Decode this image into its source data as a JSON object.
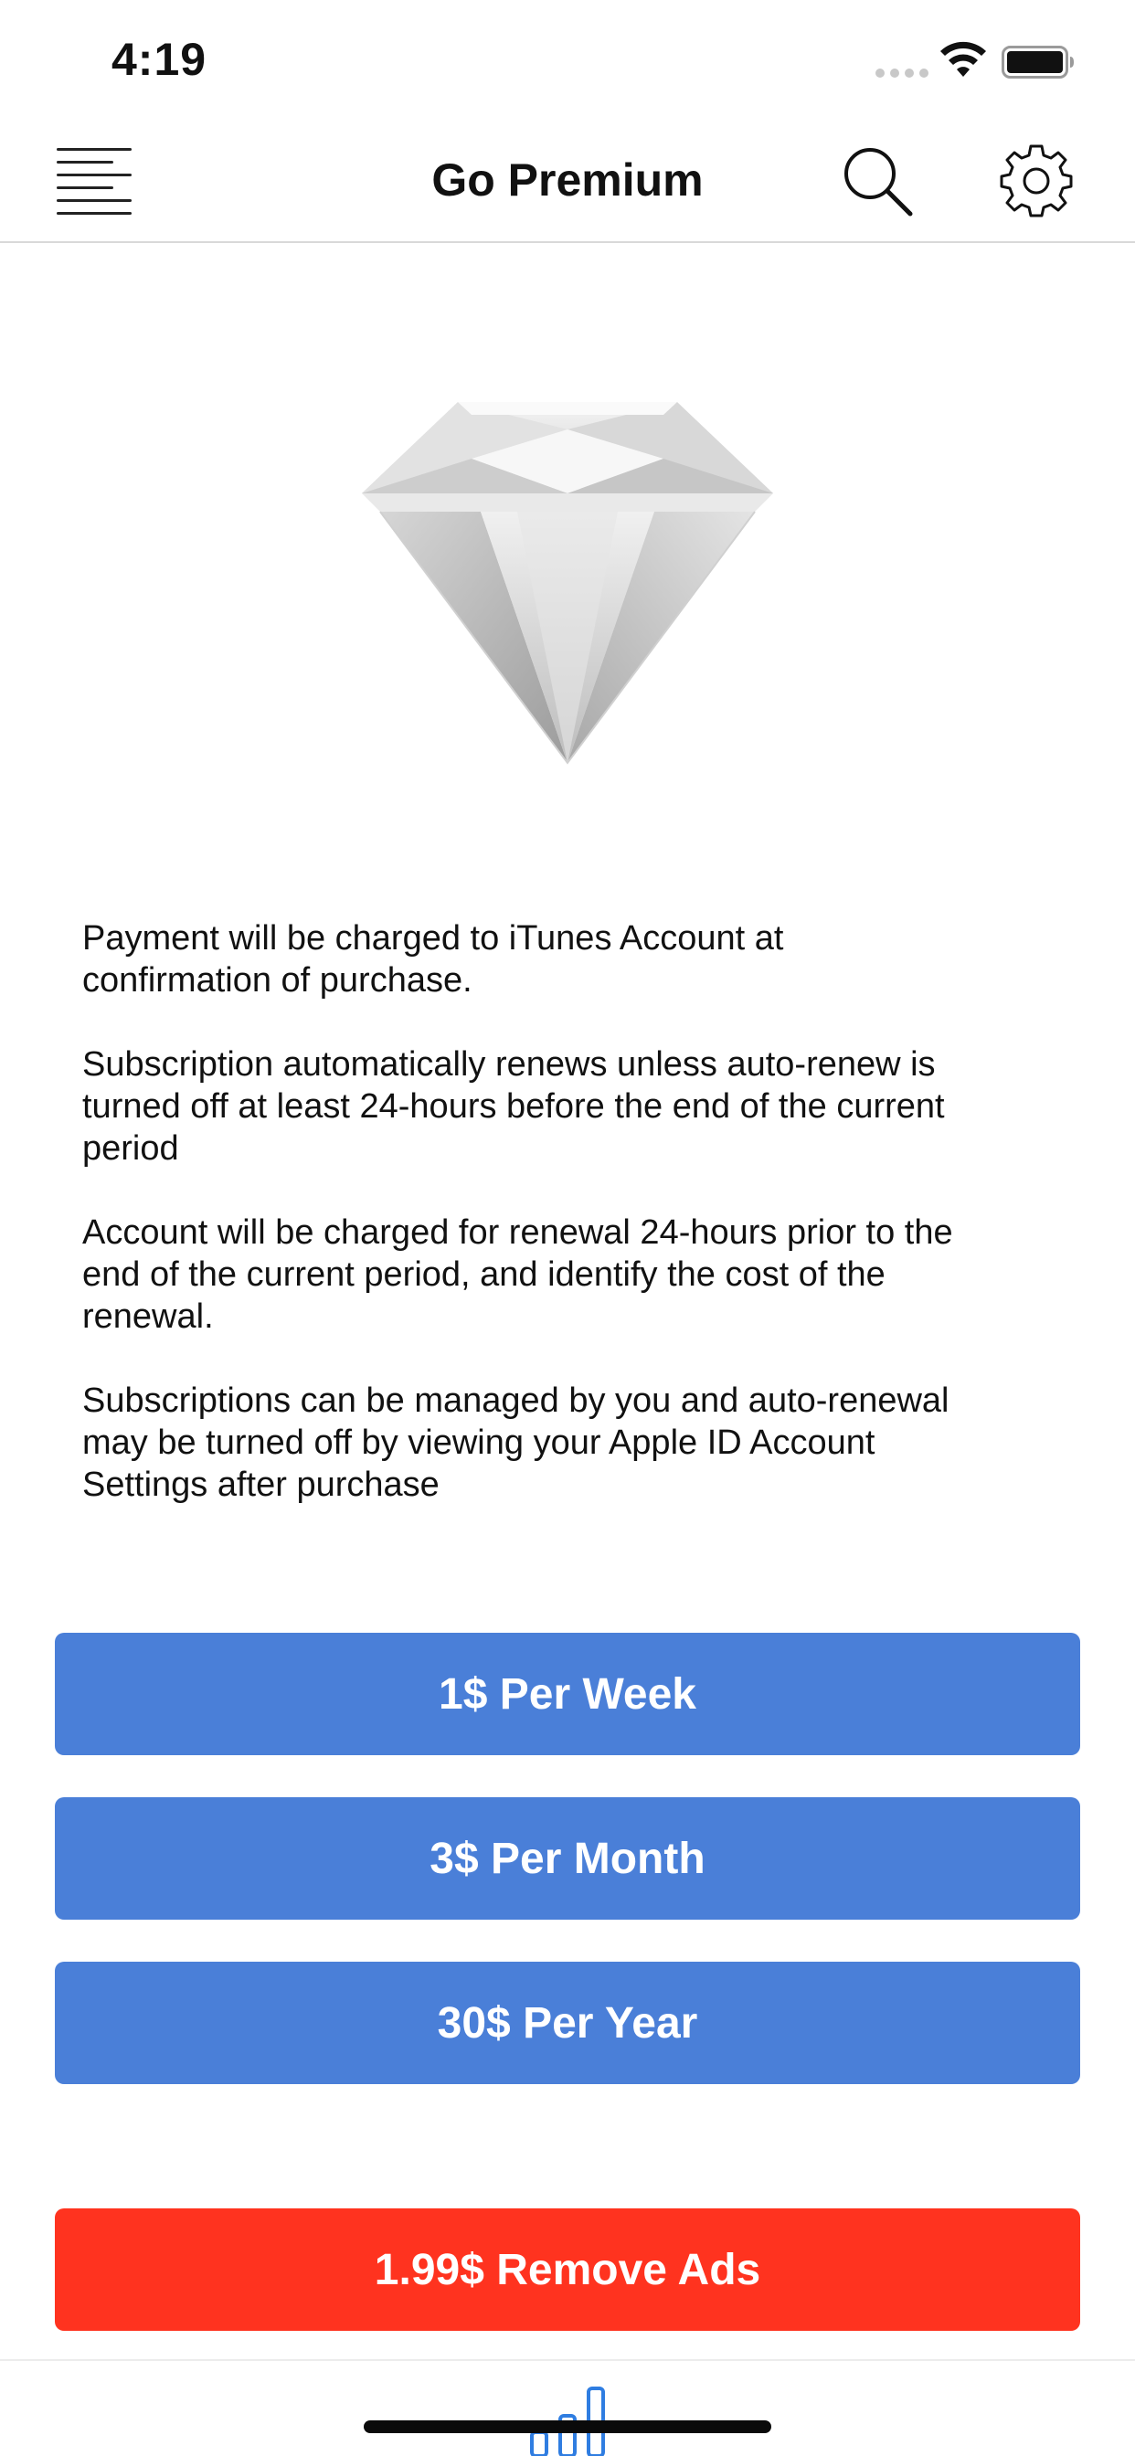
{
  "status_bar": {
    "time": "4:19"
  },
  "nav": {
    "title": "Go Premium",
    "icons": [
      "menu-icon",
      "search-icon",
      "gear-icon"
    ]
  },
  "hero": {
    "icon": "diamond-icon"
  },
  "terms": {
    "paragraphs": [
      "Payment will be charged to iTunes Account at\nconfirmation of purchase.",
      "Subscription automatically renews unless auto-renew is\nturned off at least 24-hours before the end of the current\nperiod",
      "Account will be charged for renewal 24-hours prior to the\nend of the current period, and identify the cost of the\nrenewal.",
      "Subscriptions can be managed by you and auto-renewal\nmay be turned off by viewing your Apple ID Account\nSettings after purchase"
    ]
  },
  "plans": {
    "week_label": "1$ Per Week",
    "month_label": "3$ Per Month",
    "year_label": "30$ Per Year"
  },
  "remove_ads": {
    "label": "1.99$ Remove Ads"
  },
  "tab_bar": {
    "icon": "bar-chart-icon"
  },
  "colors": {
    "plan_button": "#4a7fd8",
    "remove_ads_button": "#ff331f",
    "button_text": "#ffffff"
  }
}
